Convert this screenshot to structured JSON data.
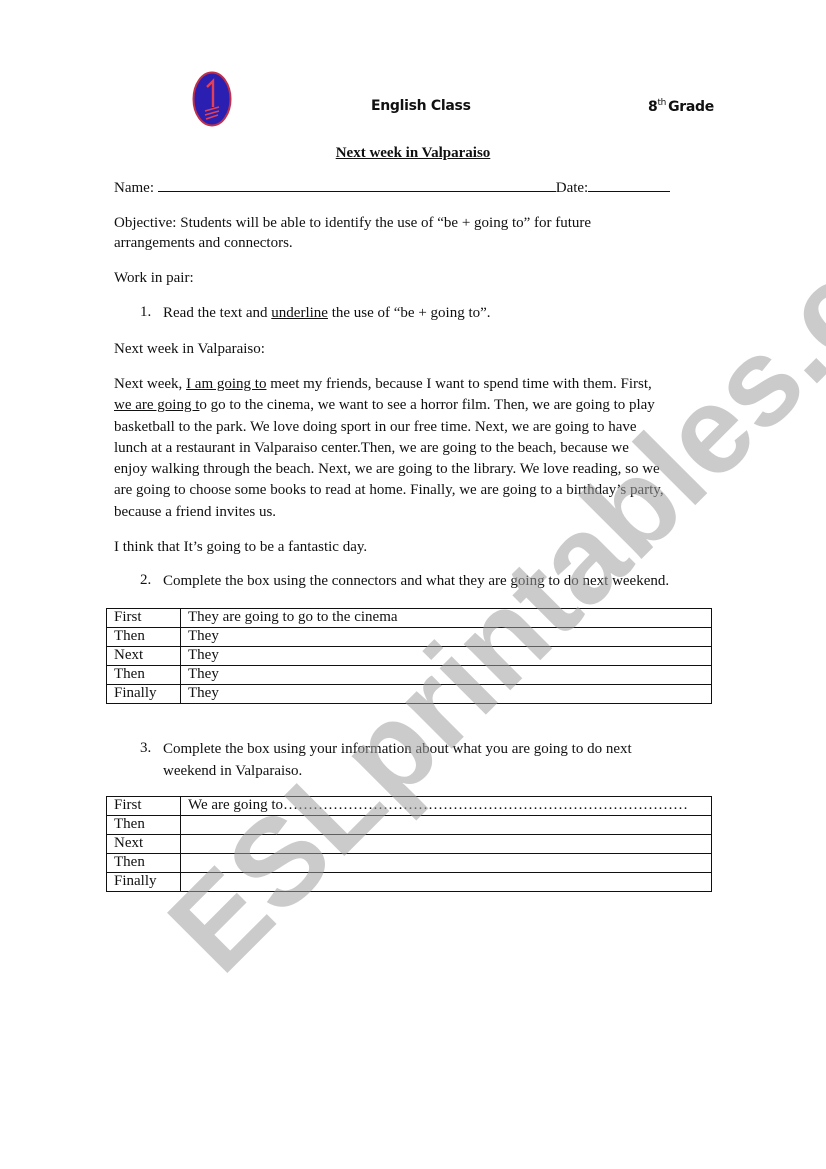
{
  "header": {
    "logo_icon": "number-one-badge-icon",
    "course": "English Class",
    "grade_number": "8",
    "grade_suffix": "th",
    "grade_label": "Grade"
  },
  "title": "Next week in Valparaiso",
  "name_label": "Name:",
  "date_label": "Date:",
  "objective": [
    "Objective: Students will be able to identify the use of “be + going to” for future",
    "arrangements and connectors."
  ],
  "work_in_pair": "Work in pair:",
  "task1": {
    "number": "1.",
    "before": "Read the text and ",
    "underlined": "underline",
    "after": " the use of “be + going to”."
  },
  "reading_title": "Next week in Valparaiso:",
  "reading": {
    "l1_a": "Next week, ",
    "l1_u": "I am going to",
    "l1_b": " meet my friends, because I want to spend time with them. First,",
    "l2_u": "we are going t",
    "l2_b": "o go to the cinema, we want to see a horror film. Then, we are going to play",
    "l3": "basketball to the park. We love doing sport in our free time. Next, we are going to have",
    "l4": "lunch at a restaurant in Valparaiso center.Then, we are going to the beach, because we",
    "l5": "enjoy walking through the beach. Next, we are going to the library. We love reading, so we",
    "l6": "are going to choose some books to read at home. Finally, we are going to a birthday’s party,",
    "l7": "because a friend invites us."
  },
  "conclusion": "I think that It’s going to be a fantastic day.",
  "task2": {
    "number": "2.",
    "text": "Complete the box using the connectors and what they are going to do next weekend.",
    "rows": [
      {
        "connector": "First",
        "answer": "They are going to  go to the cinema"
      },
      {
        "connector": "Then",
        "answer": "They"
      },
      {
        "connector": "Next",
        "answer": "They"
      },
      {
        "connector": "Then",
        "answer": "They"
      },
      {
        "connector": "Finally",
        "answer": "They"
      }
    ]
  },
  "task3": {
    "number": "3.",
    "text_line1": "Complete the box using your information about what you are going to do next",
    "text_line2": "weekend in Valparaiso.",
    "rows": [
      {
        "connector": "First",
        "answer": "We are going to………………………………………………………………………"
      },
      {
        "connector": "Then",
        "answer": ""
      },
      {
        "connector": "Next",
        "answer": ""
      },
      {
        "connector": "Then",
        "answer": ""
      },
      {
        "connector": "Finally",
        "answer": ""
      }
    ]
  },
  "watermark": "ESLprintables.com"
}
